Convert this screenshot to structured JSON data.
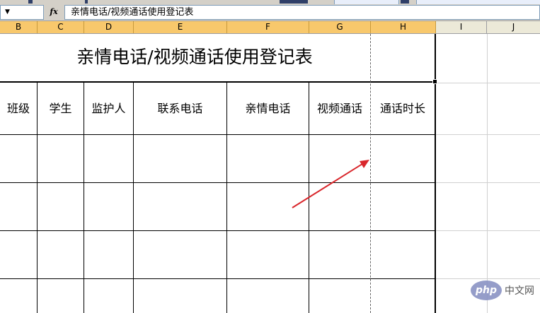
{
  "formula_bar": {
    "fx_label": "fx",
    "content": "亲情电话/视频通话使用登记表"
  },
  "columns": [
    "B",
    "C",
    "D",
    "E",
    "F",
    "G",
    "H",
    "I",
    "J"
  ],
  "sheet": {
    "title": "亲情电话/视频通话使用登记表",
    "headers": [
      "班级",
      "学生",
      "监护人",
      "联系电话",
      "亲情电话",
      "视频通话",
      "通话时长"
    ]
  },
  "watermark": {
    "logo": "php",
    "text": "中文网"
  },
  "colors": {
    "selected_column_header": "#f8c86c",
    "arrow": "#d9262b",
    "grid_line": "#d0d0d0",
    "border": "#000000"
  }
}
